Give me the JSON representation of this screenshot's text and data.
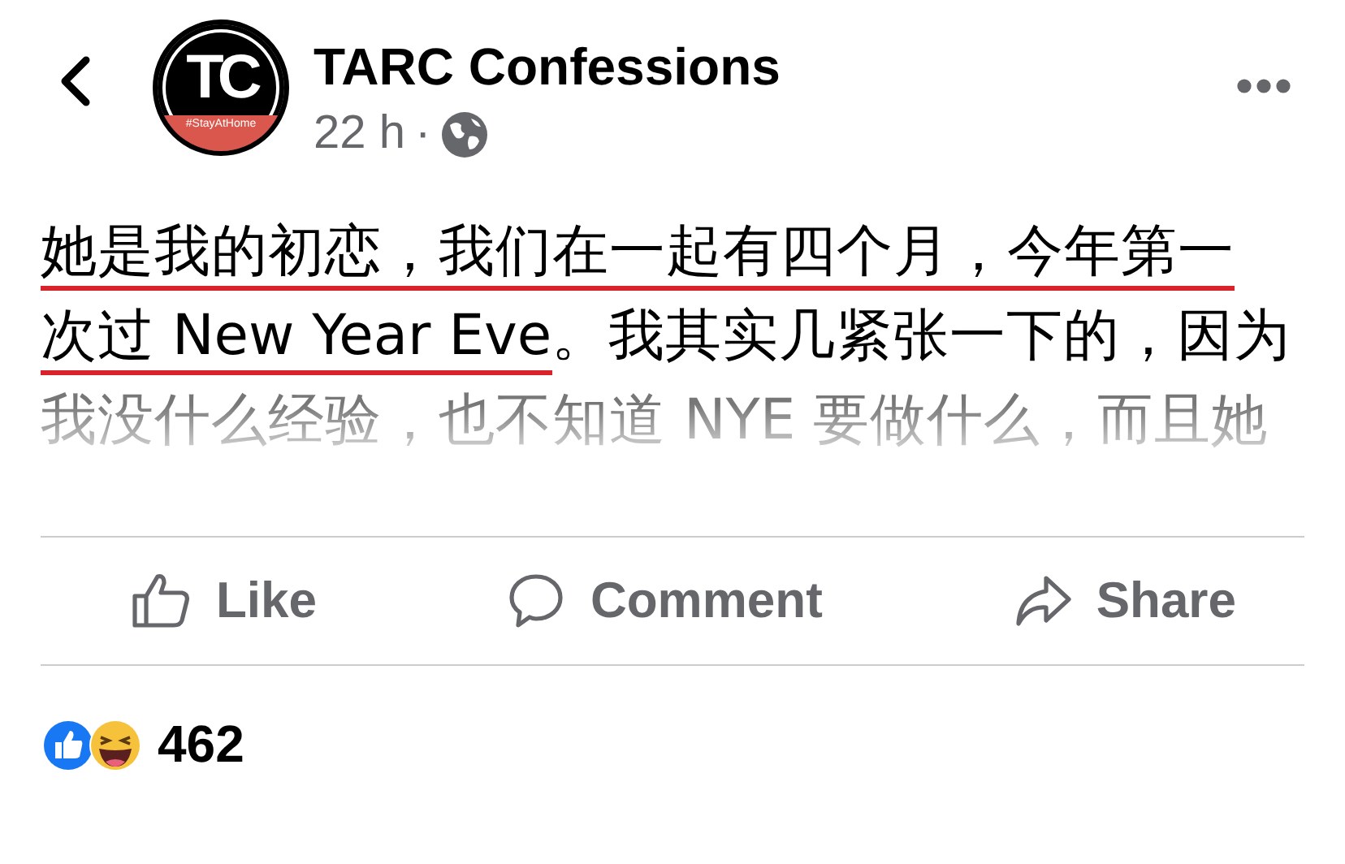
{
  "header": {
    "page_name": "TARC Confessions",
    "avatar": {
      "logo_text": "TC",
      "banner_text": "#StayAtHome"
    },
    "time": "22 h",
    "separator": "·"
  },
  "post": {
    "lines": [
      {
        "faded": false,
        "segments": [
          {
            "text": "她是我的初恋，我们在一起有四个月，今年第一",
            "underlined": true
          }
        ]
      },
      {
        "faded": false,
        "segments": [
          {
            "text": "次过 New Year Eve",
            "underlined": true
          },
          {
            "text": "。我其实几紧张一下的，因为",
            "underlined": false
          }
        ]
      },
      {
        "faded": true,
        "segments": [
          {
            "text": "我没什么经验，也不知道 NYE 要做什么，而且她",
            "underlined": false
          }
        ]
      }
    ]
  },
  "actions": [
    {
      "kind": "like",
      "label": "Like"
    },
    {
      "kind": "comment",
      "label": "Comment"
    },
    {
      "kind": "share",
      "label": "Share"
    }
  ],
  "reactions": {
    "count": "462"
  }
}
